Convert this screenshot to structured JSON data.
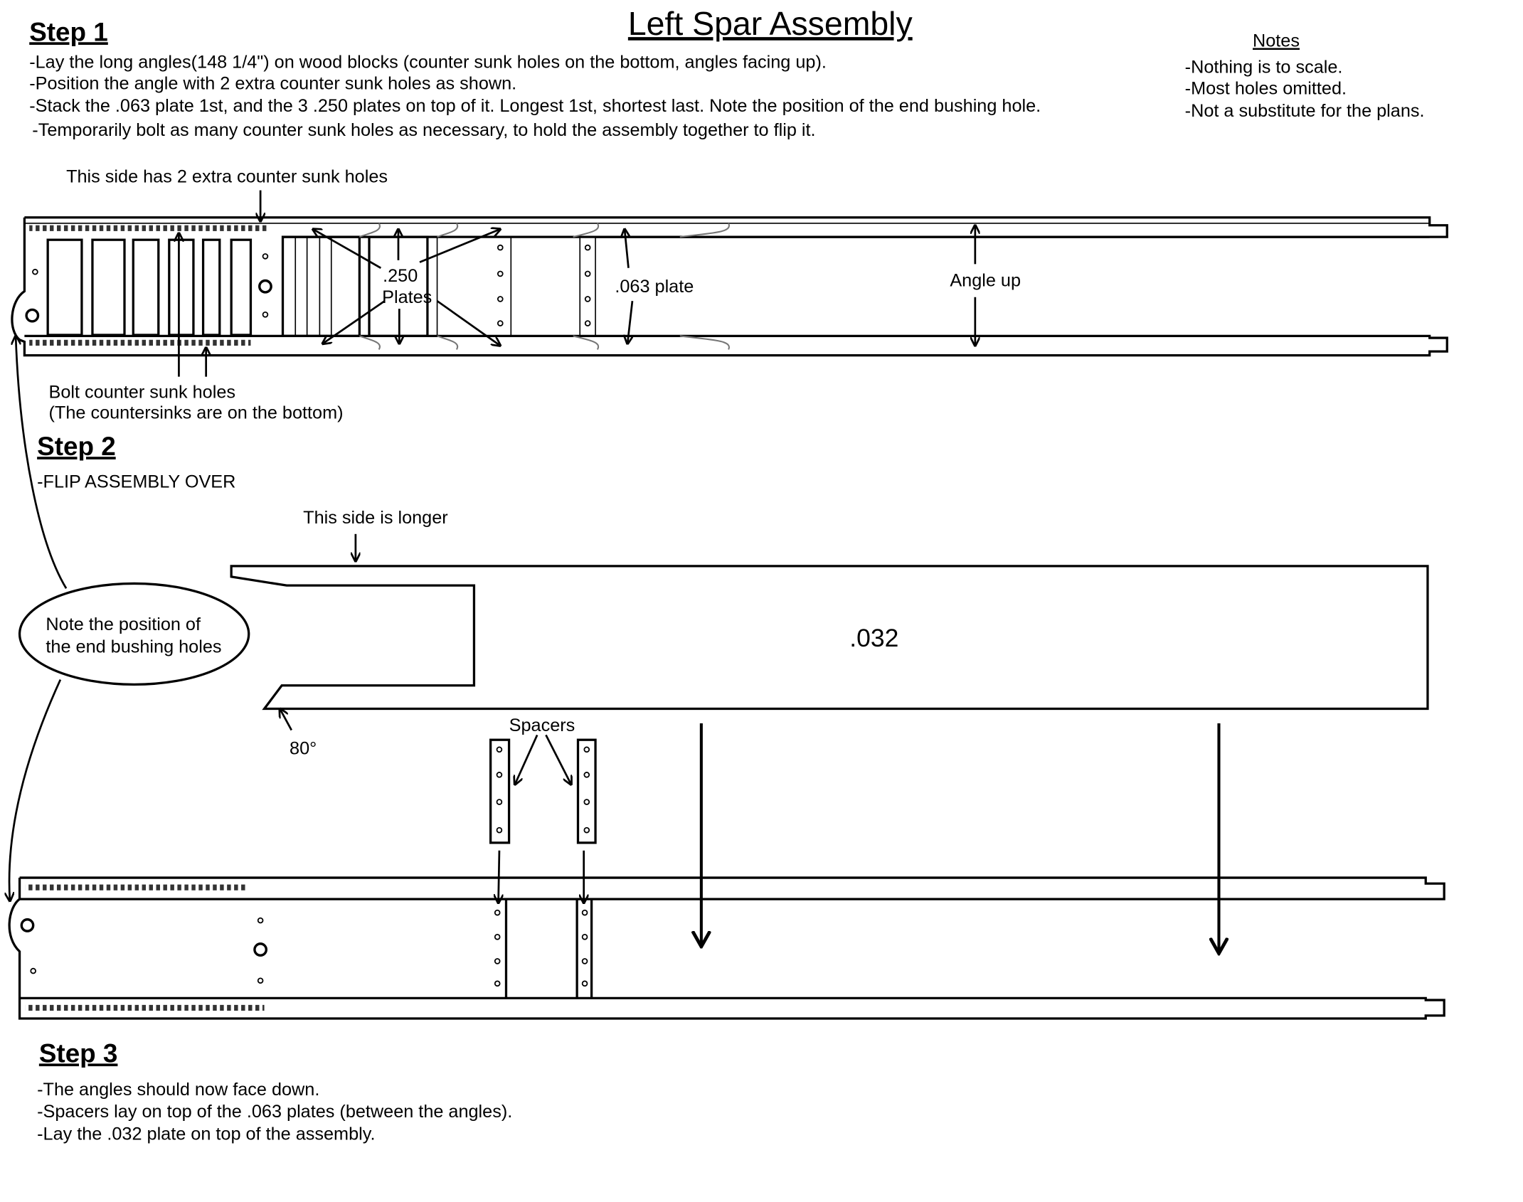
{
  "title": "Left Spar Assembly",
  "step1": {
    "heading": "Step 1",
    "lines": [
      "-Lay the long angles(148 1/4\") on wood blocks (counter sunk holes on the bottom, angles facing up).",
      "-Position the angle with 2 extra counter sunk holes as shown.",
      "-Stack the .063 plate 1st, and the 3 .250 plates on top of it. Longest 1st, shortest last. Note the position of the end bushing hole.",
      "-Temporarily bolt as many counter sunk holes as necessary, to hold the assembly together to flip it."
    ],
    "callout_extra_holes": "This side has 2 extra counter sunk holes",
    "label_250": ".250",
    "label_plates": "Plates",
    "label_063": ".063 plate",
    "label_angle_up": "Angle up",
    "bolt_label": "Bolt counter sunk holes",
    "bolt_sub": "(The countersinks are on the bottom)"
  },
  "notes": {
    "heading": "Notes",
    "lines": [
      "-Nothing is to scale.",
      "-Most holes omitted.",
      "-Not a substitute for the plans."
    ]
  },
  "step2": {
    "heading": "Step 2",
    "line": "-FLIP ASSEMBLY OVER",
    "longer_label": "This side is longer",
    "plate_label": ".032",
    "angle_label": "80°",
    "spacers_label": "Spacers",
    "bubble_line1": "Note the position of",
    "bubble_line2": "the end bushing holes"
  },
  "step3": {
    "heading": "Step 3",
    "lines": [
      "-The angles should now face down.",
      "-Spacers lay on top of the .063 plates (between the angles).",
      "-Lay the .032 plate on top of the assembly."
    ]
  }
}
